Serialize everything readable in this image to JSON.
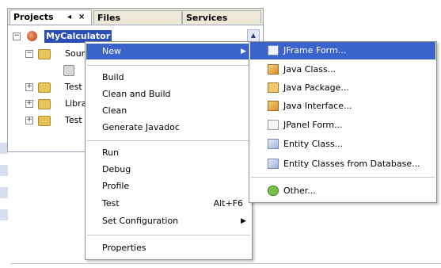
{
  "tabs": [
    {
      "label": "Projects",
      "active": true
    },
    {
      "label": "Files",
      "active": false
    },
    {
      "label": "Services",
      "active": false
    }
  ],
  "tab_controls": {
    "pin": "◂",
    "close": "×"
  },
  "tree": {
    "project": "MyCalculator",
    "nodes": [
      "Sour",
      "Test",
      "Libra",
      "Test"
    ]
  },
  "context_menu": {
    "items": [
      {
        "label": "New",
        "submenu": true,
        "highlighted": true
      },
      {
        "label": "Build"
      },
      {
        "label": "Clean and Build"
      },
      {
        "label": "Clean"
      },
      {
        "label": "Generate Javadoc"
      },
      {
        "label": "Run"
      },
      {
        "label": "Debug"
      },
      {
        "label": "Profile"
      },
      {
        "label": "Test",
        "accel": "Alt+F6"
      },
      {
        "label": "Set Configuration",
        "submenu": true
      },
      {
        "label": "Properties"
      }
    ]
  },
  "new_submenu": {
    "items": [
      {
        "label": "JFrame Form...",
        "icon": "jframe-form-icon"
      },
      {
        "label": "Java Class...",
        "icon": "java-class-icon"
      },
      {
        "label": "Java Package...",
        "icon": "java-package-icon"
      },
      {
        "label": "Java Interface...",
        "icon": "java-interface-icon"
      },
      {
        "label": "JPanel Form...",
        "icon": "jpanel-form-icon"
      },
      {
        "label": "Entity Class...",
        "icon": "entity-class-icon"
      },
      {
        "label": "Entity Classes from Database...",
        "icon": "entity-db-icon"
      },
      {
        "label": "Other...",
        "icon": "other-icon"
      }
    ]
  },
  "colors": {
    "highlight": "#3a63cc",
    "selection": "#2a4fb6"
  }
}
